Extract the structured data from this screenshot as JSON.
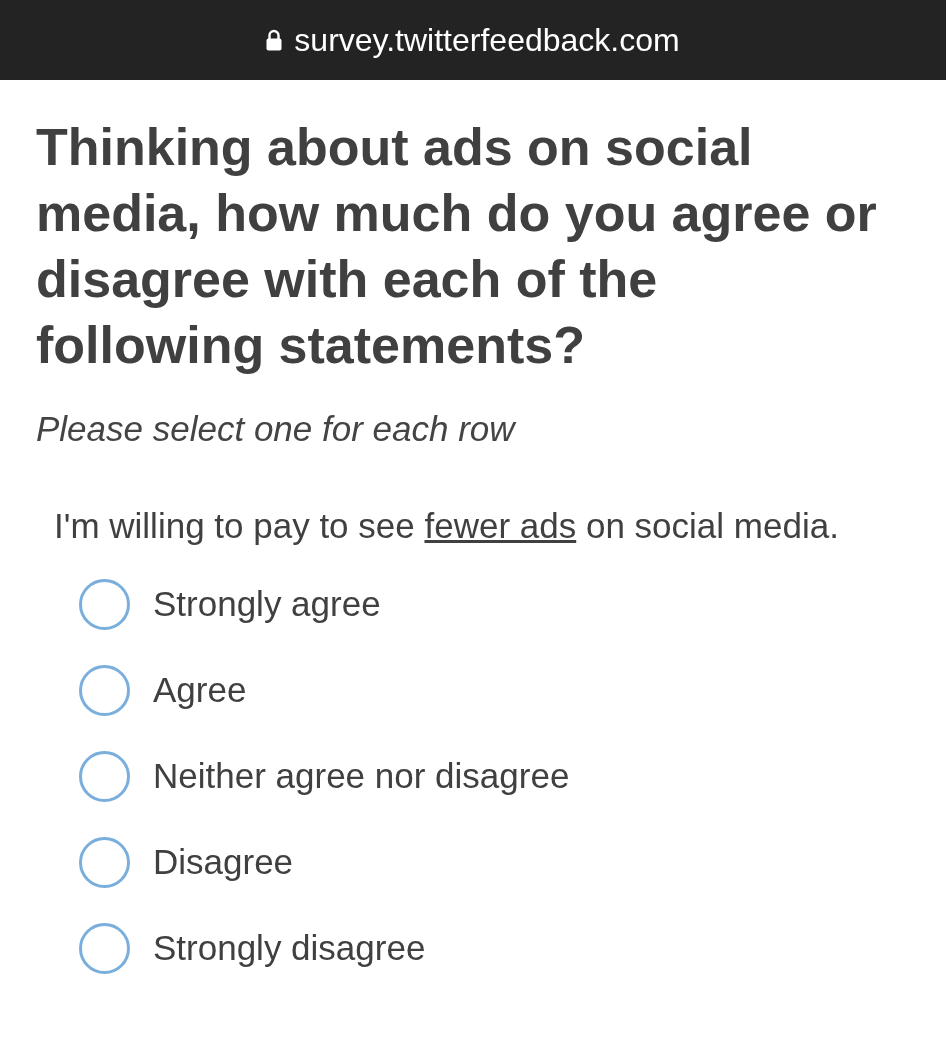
{
  "address_bar": {
    "url": "survey.twitterfeedback.com"
  },
  "question": {
    "title": "Thinking about ads on social media, how much do you agree or disagree with each of the following statements?",
    "instruction": "Please select one for each row"
  },
  "statement": {
    "before": "I'm willing to pay to see",
    "link": "fewer ads",
    "after": "on social media."
  },
  "options": [
    {
      "label": "Strongly agree",
      "selected": false
    },
    {
      "label": "Agree",
      "selected": false
    },
    {
      "label": "Neither agree nor disagree",
      "selected": false
    },
    {
      "label": "Disagree",
      "selected": false
    },
    {
      "label": "Strongly disagree",
      "selected": false
    }
  ]
}
